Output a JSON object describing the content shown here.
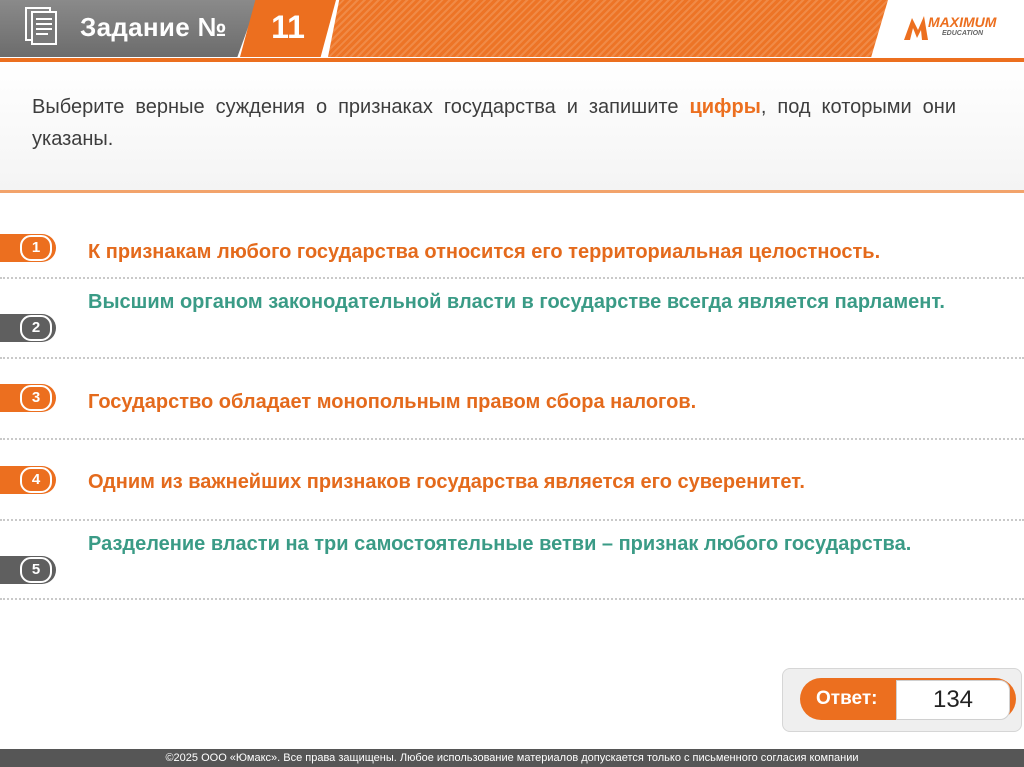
{
  "header": {
    "title": "Задание №",
    "task_number": "11",
    "logo_main": "MAXIMUM",
    "logo_sub": "EDUCATION",
    "doc_icon": "document-icon"
  },
  "question": {
    "text_before": "Выберите верные суждения о признаках государства и запишите",
    "highlight": "цифры",
    "text_after": ", под которыми они указаны."
  },
  "items": [
    {
      "num": "1",
      "text": "К признакам любого государства относится его территориальная целостность.",
      "badge_color": "#ec6f1f",
      "text_color": "#e46a1c"
    },
    {
      "num": "2",
      "text": "Высшим органом законодательной власти в государстве всегда является парламент.",
      "badge_color": "#5f5f5f",
      "text_color": "#3a9b86"
    },
    {
      "num": "3",
      "text": "Государство обладает монопольным правом сбора налогов.",
      "badge_color": "#ec6f1f",
      "text_color": "#e46a1c"
    },
    {
      "num": "4",
      "text": "Одним из важнейших признаков государства является его суверенитет.",
      "badge_color": "#ec6f1f",
      "text_color": "#e46a1c"
    },
    {
      "num": "5",
      "text": "Разделение власти на три самостоятельные ветви – признак любого государства.",
      "badge_color": "#5f5f5f",
      "text_color": "#3a9b86"
    }
  ],
  "answer": {
    "label": "Ответ:",
    "value": "134"
  },
  "footer": {
    "text": "©2025 ООО «Юмакс». Все права защищены. Любое использование материалов допускается только с письменного согласия компании"
  },
  "colors": {
    "accent": "#ec6f1f",
    "correct_text": "#e46a1c",
    "incorrect_text": "#3a9b86",
    "header_gray": "#7a7a7a"
  }
}
